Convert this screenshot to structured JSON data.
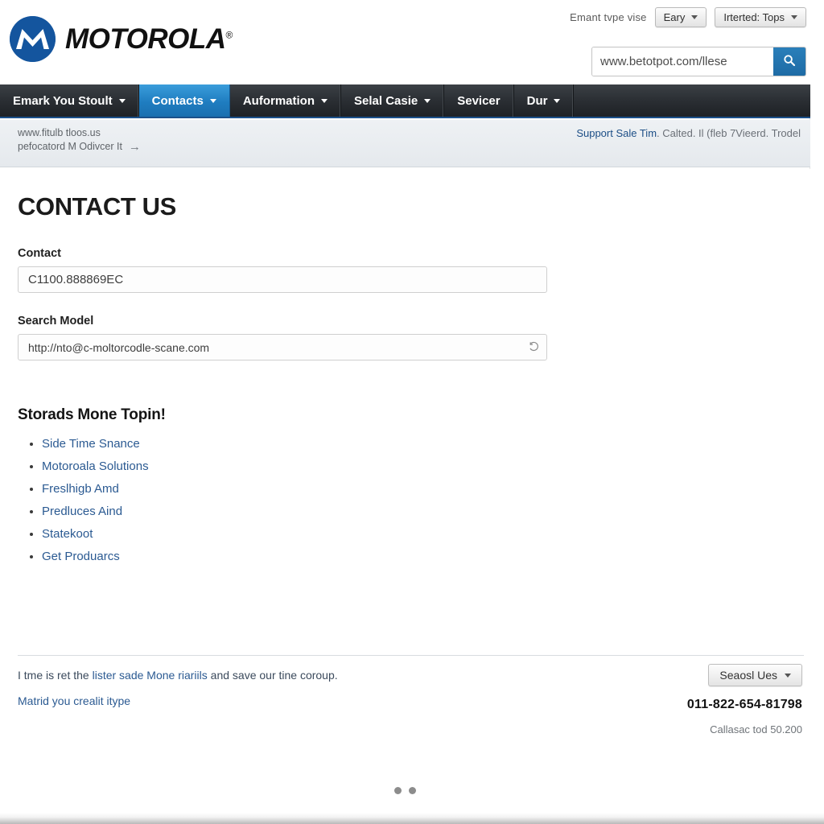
{
  "brand": {
    "logo_text": "MOTOROLA",
    "logo_reg": "®",
    "logo_color": "#14559e"
  },
  "utility": {
    "label": "Emant tvpe vise",
    "dropdown1": "Eary",
    "dropdown2": "Irterted: Tops"
  },
  "search": {
    "value": "www.betotpot.com/llese",
    "placeholder": "www.betotpot.com/llese",
    "icon": "search-icon",
    "button_color": "#1e6ba5"
  },
  "nav": {
    "items": [
      {
        "label": "Emark You Stoult",
        "caret": true,
        "active": false
      },
      {
        "label": "Contacts",
        "caret": true,
        "active": true
      },
      {
        "label": "Auformation",
        "caret": true,
        "active": false
      },
      {
        "label": "Selal Casie",
        "caret": true,
        "active": false
      },
      {
        "label": "Sevicer",
        "caret": false,
        "active": false
      },
      {
        "label": "Dur",
        "caret": true,
        "active": false
      }
    ],
    "active_color": "#1f7dc0"
  },
  "breadcrumb": {
    "line1": "www.fitulb tloos.us",
    "line2": "pefocatord M Odivcer It",
    "arrow": "→",
    "right_links": "Support Sale Tim",
    "right_rest": ". Calted. Il (fleb 7Vieerd. Trodel"
  },
  "main": {
    "title": "CONTACT US",
    "contact_label": "Contact",
    "contact_value": "C1100.888869EC",
    "contact_placeholder": "C1100.888869EC",
    "model_label": "Search Model",
    "model_value": "http://nto@c-moltorcodle-scane.com",
    "model_placeholder": "http://nto@c-moltorcodle-scane.com",
    "section_title": "Storads Mone Topin!",
    "links": [
      "Side Time Snance",
      "Motoroala Solutions",
      "Freslhigb Amd",
      "Predluces Aind",
      "Statekoot",
      "Get Produarcs"
    ]
  },
  "footer": {
    "note_plain1": "I tme is ret the ",
    "note_link": "lister sade Mone riariils",
    "note_plain2": " and save our tine coroup.",
    "link": "Matrid you crealit itype",
    "dropdown": "Seaosl Ues",
    "phone": "011-822-654-81798",
    "small": "Callasac tod 50.200"
  },
  "carousel": {
    "dots": [
      1,
      2
    ]
  }
}
